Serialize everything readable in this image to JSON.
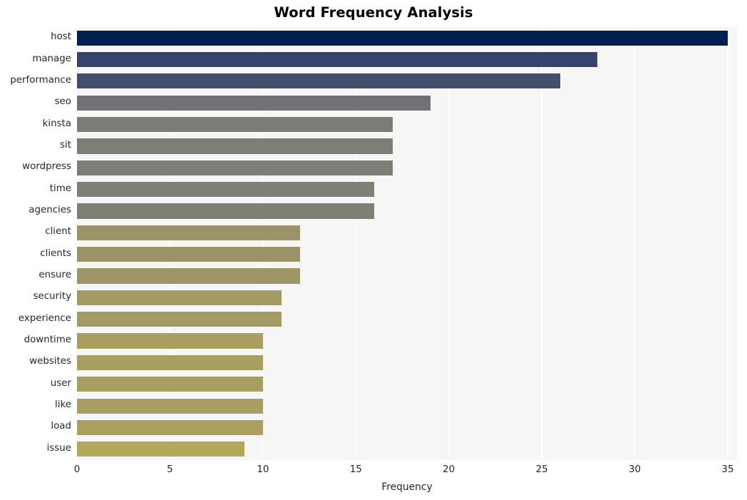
{
  "chart_data": {
    "type": "bar",
    "orientation": "horizontal",
    "title": "Word Frequency Analysis",
    "xlabel": "Frequency",
    "ylabel": "",
    "categories": [
      "host",
      "manage",
      "performance",
      "seo",
      "kinsta",
      "sit",
      "wordpress",
      "time",
      "agencies",
      "client",
      "clients",
      "ensure",
      "security",
      "experience",
      "downtime",
      "websites",
      "user",
      "like",
      "load",
      "issue"
    ],
    "values": [
      35,
      28,
      26,
      19,
      17,
      17,
      17,
      16,
      16,
      12,
      12,
      12,
      11,
      11,
      10,
      10,
      10,
      10,
      10,
      9
    ],
    "bar_colors": [
      "#002052",
      "#37436c",
      "#414e6e",
      "#717276",
      "#7c7c77",
      "#7e7d76",
      "#7e7d76",
      "#807f75",
      "#807f75",
      "#9c9468",
      "#9c9468",
      "#9e9667",
      "#a49a64",
      "#a49a64",
      "#a99e61",
      "#a99e61",
      "#a99e61",
      "#a99e61",
      "#ab9f60",
      "#b5a75a"
    ],
    "xlim": [
      0,
      35.5
    ],
    "xticks": [
      "0",
      "5",
      "10",
      "15",
      "20",
      "25",
      "30",
      "35"
    ],
    "xtick_values": [
      0,
      5,
      10,
      15,
      20,
      25,
      30,
      35
    ],
    "grid": "vertical-only",
    "legend": "none",
    "plot_background": "#f6f6f7",
    "figure_background": "#ffffff",
    "gridline_color": "#ffffff",
    "tick_label_color": "#262626",
    "title_color": "#000000"
  }
}
